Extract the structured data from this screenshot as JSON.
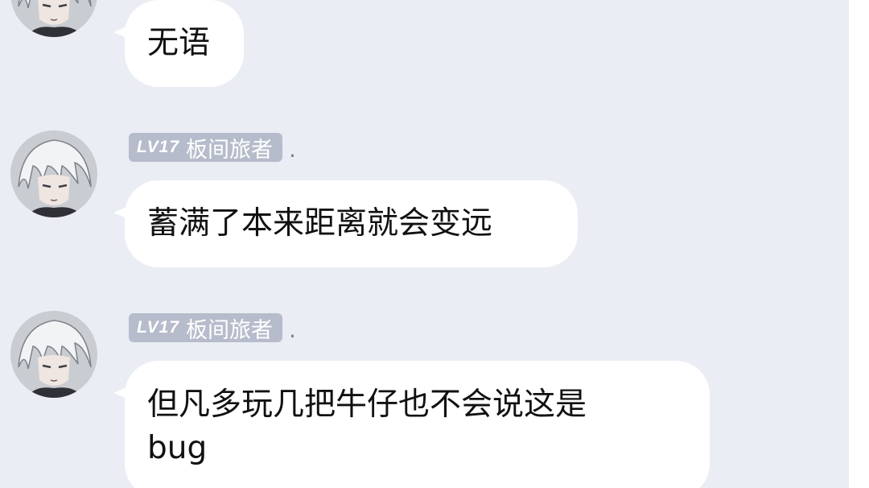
{
  "colors": {
    "background": "#ebedf5",
    "bubble": "#ffffff",
    "badge": "#b6bccb",
    "text": "#111111"
  },
  "messages": [
    {
      "level": "",
      "nickname": "",
      "text": "无语"
    },
    {
      "level": "LV17",
      "nickname": "板间旅者",
      "suffix": ".",
      "text": "蓄满了本来距离就会变远"
    },
    {
      "level": "LV17",
      "nickname": "板间旅者",
      "suffix": ".",
      "text": "但凡多玩几把牛仔也不会说这是\nbug"
    }
  ],
  "avatar_icon": "anime-avatar-icon"
}
